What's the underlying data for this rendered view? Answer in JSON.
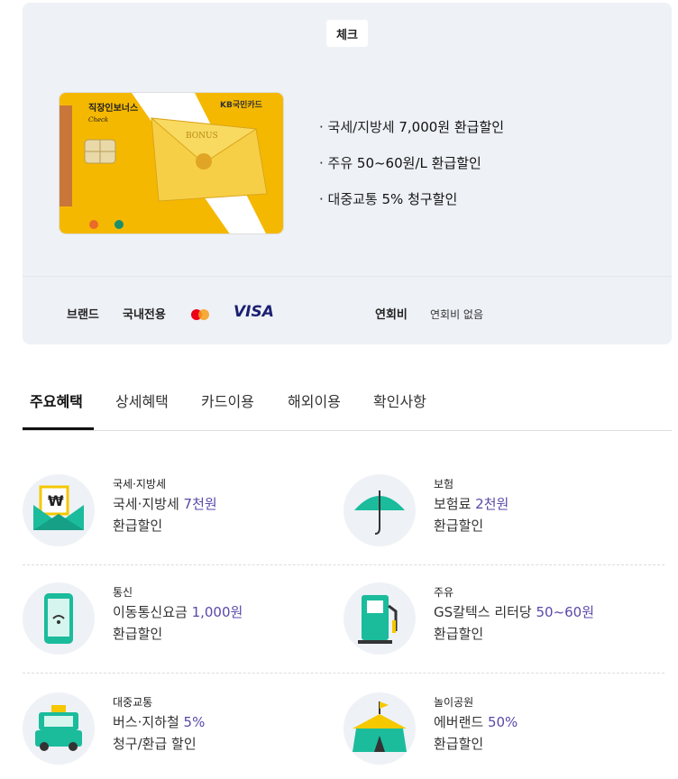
{
  "card": {
    "type_badge": "체크",
    "image_alt": "직장인보너스 체크카드",
    "card_title_text": "직장인보너스",
    "card_subtitle": "Check",
    "issuer_logo": "KB국민카드",
    "envelope_text": "BONUS",
    "summary": [
      {
        "prefix": "· 국세/지방세 ",
        "value": "7,000원 환급할인"
      },
      {
        "prefix": "· 주유 ",
        "value": "50~60원/L 환급할인"
      },
      {
        "prefix": "· 대중교통 ",
        "value": "5% 청구할인"
      }
    ],
    "brand_label": "브랜드",
    "brand_domestic": "국내전용",
    "brand_visa": "VISA",
    "annual_fee_label": "연회비",
    "annual_fee_value": "연회비 없음"
  },
  "tabs": [
    "주요혜택",
    "상세혜택",
    "카드이용",
    "해외이용",
    "확인사항"
  ],
  "benefits": [
    {
      "category": "국세·지방세",
      "line1_pre": "국세·지방세 ",
      "line1_hl": "7천원",
      "line2": "환급할인",
      "icon": "tax-envelope-icon"
    },
    {
      "category": "보험",
      "line1_pre": "보험료 ",
      "line1_hl": "2천원",
      "line2": "환급할인",
      "icon": "umbrella-icon"
    },
    {
      "category": "통신",
      "line1_pre": "이동통신요금 ",
      "line1_hl": "1,000원",
      "line2": "환급할인",
      "icon": "phone-icon"
    },
    {
      "category": "주유",
      "line1_pre": "GS칼텍스 리터당 ",
      "line1_hl": "50~60원",
      "line2": "환급할인",
      "icon": "gas-pump-icon"
    },
    {
      "category": "대중교통",
      "line1_pre": "버스·지하철 ",
      "line1_hl": "5%",
      "line2": "청구/환급 할인",
      "icon": "taxi-icon"
    },
    {
      "category": "놀이공원",
      "line1_pre": "에버랜드 ",
      "line1_hl": "50%",
      "line2": "환급할인",
      "icon": "circus-tent-icon"
    }
  ],
  "colors": {
    "accent": "#5a48a8",
    "panel_bg": "#eef1f6",
    "icon_teal": "#1abc9c",
    "card_yellow": "#f5b800"
  }
}
